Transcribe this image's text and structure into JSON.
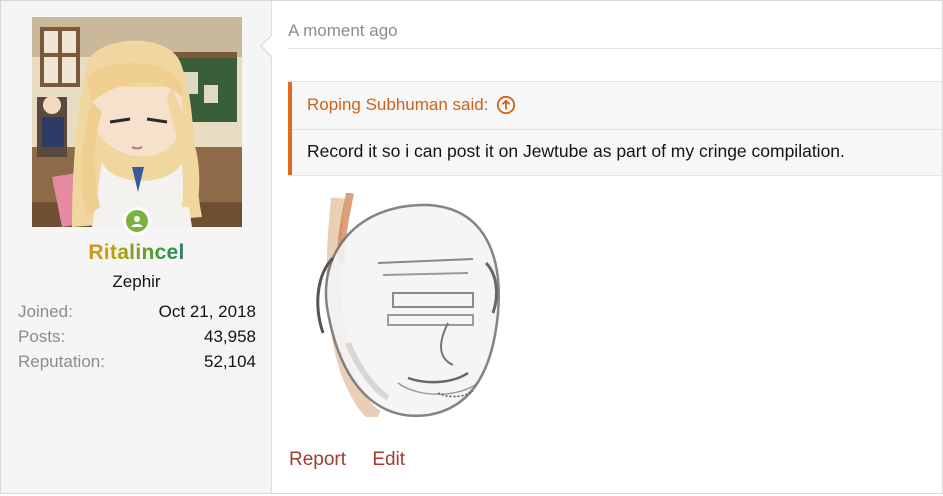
{
  "user": {
    "name": "Ritalincel",
    "title": "Zephir",
    "status": "online",
    "name_gradient": [
      "#d2232a",
      "#e0741f",
      "#c9a20b",
      "#2f9a3b",
      "#2a55c6",
      "#7b2fbf"
    ],
    "stats": [
      {
        "label": "Joined:",
        "value": "Oct 21, 2018"
      },
      {
        "label": "Posts:",
        "value": "43,958"
      },
      {
        "label": "Reputation:",
        "value": "52,104"
      }
    ]
  },
  "post": {
    "time": "A moment ago",
    "quote": {
      "author_line": "Roping Subhuman said:",
      "text": "Record it so i can post it on Jewtube as part of my cringe compilation."
    },
    "actions": {
      "report": "Report",
      "edit": "Edit"
    }
  },
  "colors": {
    "quote_accent": "#e06b1a",
    "quote_author": "#d06217",
    "action_link": "#a33a35",
    "online": "#7ab33c"
  },
  "icons": {
    "quote_jump": "arrow-up-circle-icon",
    "online": "user-icon"
  }
}
